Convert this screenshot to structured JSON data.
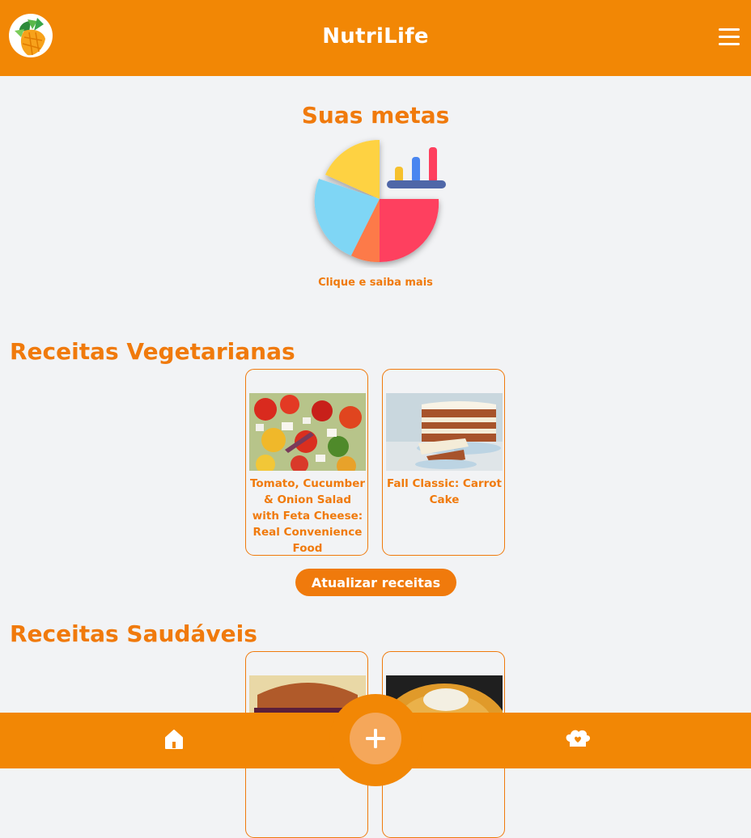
{
  "header": {
    "title": "NutriLife",
    "logo_icon": "vegetables-logo-icon",
    "menu_icon": "hamburger-menu-icon"
  },
  "goals": {
    "title": "Suas metas",
    "link_label": "Clique e saiba mais",
    "chart_icon": "pie-bar-chart-icon"
  },
  "vegetarian": {
    "title": "Receitas Vegetarianas",
    "recipes": [
      {
        "title": "Tomato, Cucumber & Onion Salad with Feta Cheese: Real Convenience Food"
      },
      {
        "title": "Fall Classic: Carrot Cake"
      }
    ],
    "refresh_label": "Atualizar receitas"
  },
  "healthy": {
    "title": "Receitas Saudáveis",
    "recipes": [
      {
        "title": ""
      },
      {
        "title": ""
      }
    ]
  },
  "bottom_nav": {
    "home_icon": "home-icon",
    "add_icon": "plus-icon",
    "fav_icon": "chef-hat-icon"
  },
  "colors": {
    "primary": "#f28705",
    "accent_text": "#f07a0c",
    "background": "#f2f3f5"
  }
}
